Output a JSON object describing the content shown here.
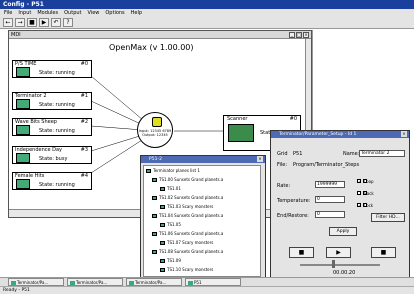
{
  "app": {
    "title": "Config - P51"
  },
  "menu": [
    "File",
    "Input",
    "Modules",
    "Output",
    "View",
    "Options",
    "Help"
  ],
  "toolbar": [
    "←",
    "→",
    "■",
    "▶",
    "↶",
    "?"
  ],
  "main_window": {
    "title": "MDI",
    "heading": "OpenMax (v 1.00.00)"
  },
  "nodes": [
    {
      "name": "P/S TIME",
      "id": "#0",
      "status": "State: running"
    },
    {
      "name": "Terminator 2",
      "id": "#1",
      "status": "State: running"
    },
    {
      "name": "Wave Bits Sheep",
      "id": "#2",
      "status": "State: running"
    },
    {
      "name": "Independence Day",
      "id": "#3",
      "status": "State: busy"
    },
    {
      "name": "Female Hits",
      "id": "#4",
      "status": "State: running"
    }
  ],
  "hub": {
    "label": "Input: 12345 6789 Output: 12345"
  },
  "scanner": {
    "name": "Scanner",
    "id": "#0",
    "status": "State: running"
  },
  "tree_window": {
    "title": "P51-2",
    "root": "Terminator planes list 1",
    "items": [
      {
        "label": "TS1.00",
        "detail": "Sunsets Grand planets.a"
      },
      {
        "label": "TS1.01",
        "detail": ""
      },
      {
        "label": "TS1.02",
        "detail": "Sunsets Grand planets.a"
      },
      {
        "label": "TS1.03",
        "detail": "Scary monsters"
      },
      {
        "label": "TS1.04",
        "detail": "Sunsets Grand planets.a"
      },
      {
        "label": "TS1.05",
        "detail": ""
      },
      {
        "label": "TS1.06",
        "detail": "Sunsets Grand planets.a"
      },
      {
        "label": "TS1.07",
        "detail": "Scary monsters"
      },
      {
        "label": "TS1.08",
        "detail": "Sunsets Grand planets.a"
      },
      {
        "label": "TS1.09",
        "detail": ""
      },
      {
        "label": "TS1.10",
        "detail": "Scary monsters"
      }
    ]
  },
  "props_window": {
    "title": "Terminator/Parameter_Setup - Id 1",
    "grid_label": "Grid",
    "grid_value": "P51",
    "name_label": "Name:",
    "name_value": "Terminator 2",
    "file_label": "File:",
    "file_value": "Program/Terminator_Steps",
    "rate_label": "Rate:",
    "rate_value": "1999999",
    "temp_label": "Temperature:",
    "temp_value": "0",
    "end_label": "End/Restore:",
    "end_value": "0",
    "checks": [
      {
        "label": "Loop",
        "checked": true
      },
      {
        "label": "Back",
        "checked": false
      },
      {
        "label": "Lock",
        "checked": true
      }
    ],
    "filter_button": "Filter HD...",
    "apply_button": "Apply",
    "controls": [
      "■",
      "▶",
      "■"
    ],
    "time": "00.00.20"
  },
  "taskbar": [
    "Terminator/Pa...",
    "Terminator/Pa...",
    "Terminator/Pa...",
    "P51"
  ],
  "statusbar": {
    "text": "Ready - P51"
  }
}
